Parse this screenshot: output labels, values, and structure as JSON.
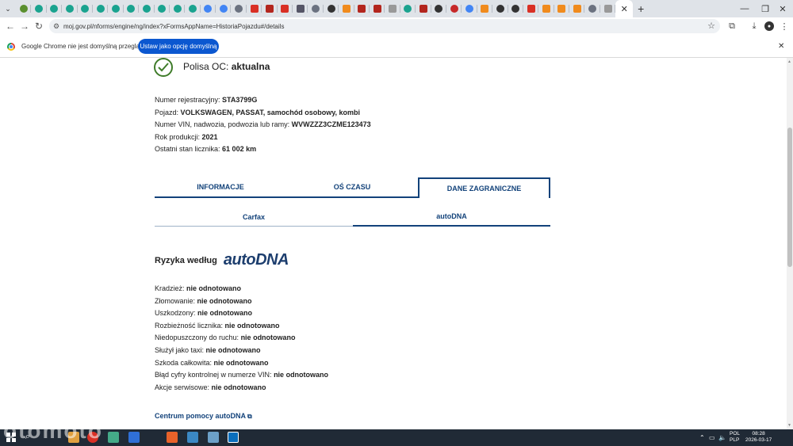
{
  "browser": {
    "url": "moj.gov.pl/nforms/engine/ng/index?xFormsAppName=HistoriaPojazdu#/details",
    "active_tab_close": "✕",
    "new_tab": "+",
    "window_controls": {
      "minimize": "—",
      "maximize": "❐",
      "close": "✕"
    }
  },
  "infobar": {
    "text": "Google Chrome nie jest domyślną przeglądarką",
    "button_label": "Ustaw jako opcję domyślną",
    "close": "✕"
  },
  "page": {
    "policy": {
      "label": "Polisa OC: ",
      "status": "aktualna"
    },
    "details": [
      {
        "label": "Numer rejestracyjny: ",
        "value": "STA3799G"
      },
      {
        "label": "Pojazd: ",
        "value": "VOLKSWAGEN, PASSAT, samochód osobowy, kombi"
      },
      {
        "label": "Numer VIN, nadwozia, podwozia lub ramy: ",
        "value": "WVWZZZ3CZME123473"
      },
      {
        "label": "Rok produkcji: ",
        "value": "2021"
      },
      {
        "label": "Ostatni stan licznika: ",
        "value": "61 002 km"
      }
    ],
    "main_tabs": [
      "INFORMACJE",
      "OŚ CZASU",
      "DANE ZAGRANICZNE"
    ],
    "active_main_tab": "DANE ZAGRANICZNE",
    "sub_tabs": [
      "Carfax",
      "autoDNA"
    ],
    "active_sub_tab": "autoDNA",
    "risks_heading": "Ryzyka według",
    "risks_logo": "autoDNA",
    "risks": [
      {
        "label": "Kradzież: ",
        "value": "nie odnotowano"
      },
      {
        "label": "Złomowanie: ",
        "value": "nie odnotowano"
      },
      {
        "label": "Uszkodzony: ",
        "value": "nie odnotowano"
      },
      {
        "label": "Rozbieżność licznika: ",
        "value": "nie odnotowano"
      },
      {
        "label": "Niedopuszczony do ruchu: ",
        "value": "nie odnotowano"
      },
      {
        "label": "Służył jako taxi: ",
        "value": "nie odnotowano"
      },
      {
        "label": "Szkoda całkowita: ",
        "value": "nie odnotowano"
      },
      {
        "label": "Błąd cyfry kontrolnej w numerze VIN: ",
        "value": "nie odnotowano"
      },
      {
        "label": "Akcje serwisowe: ",
        "value": "nie odnotowano"
      }
    ],
    "help_link": "Centrum pomocy autoDNA"
  },
  "taskbar": {
    "lang_top": "POL",
    "lang_bottom": "PLP",
    "time": "08:28",
    "date": "2026-03-17",
    "watermark": "otomoto"
  },
  "colors": {
    "accent": "#12427a",
    "success": "#3f7c2a",
    "infobar_button": "#0b57d0",
    "taskbar": "#202a36"
  },
  "tab_favicons": [
    "green-circle-icon",
    "teal-icon",
    "teal-icon",
    "teal-icon",
    "teal-icon",
    "teal-icon",
    "teal-icon",
    "teal-icon",
    "teal-icon",
    "teal-icon",
    "teal-icon",
    "teal-icon",
    "google-icon",
    "google-icon",
    "chrome-icon",
    "gmail-icon",
    "pdf-icon",
    "gmail-icon",
    "mountain-icon",
    "chrome-icon",
    "vw-icon",
    "amazon-icon",
    "pdf-icon",
    "pdf-icon",
    "grey-icon",
    "teal-icon",
    "pdf-icon",
    "vw-icon",
    "red-circle-icon",
    "google-icon",
    "amazon-icon",
    "vw-icon",
    "vw-icon",
    "gmail-icon",
    "amazon-icon",
    "amazon-icon",
    "amazon-icon",
    "chrome-icon",
    "grey-icon"
  ]
}
